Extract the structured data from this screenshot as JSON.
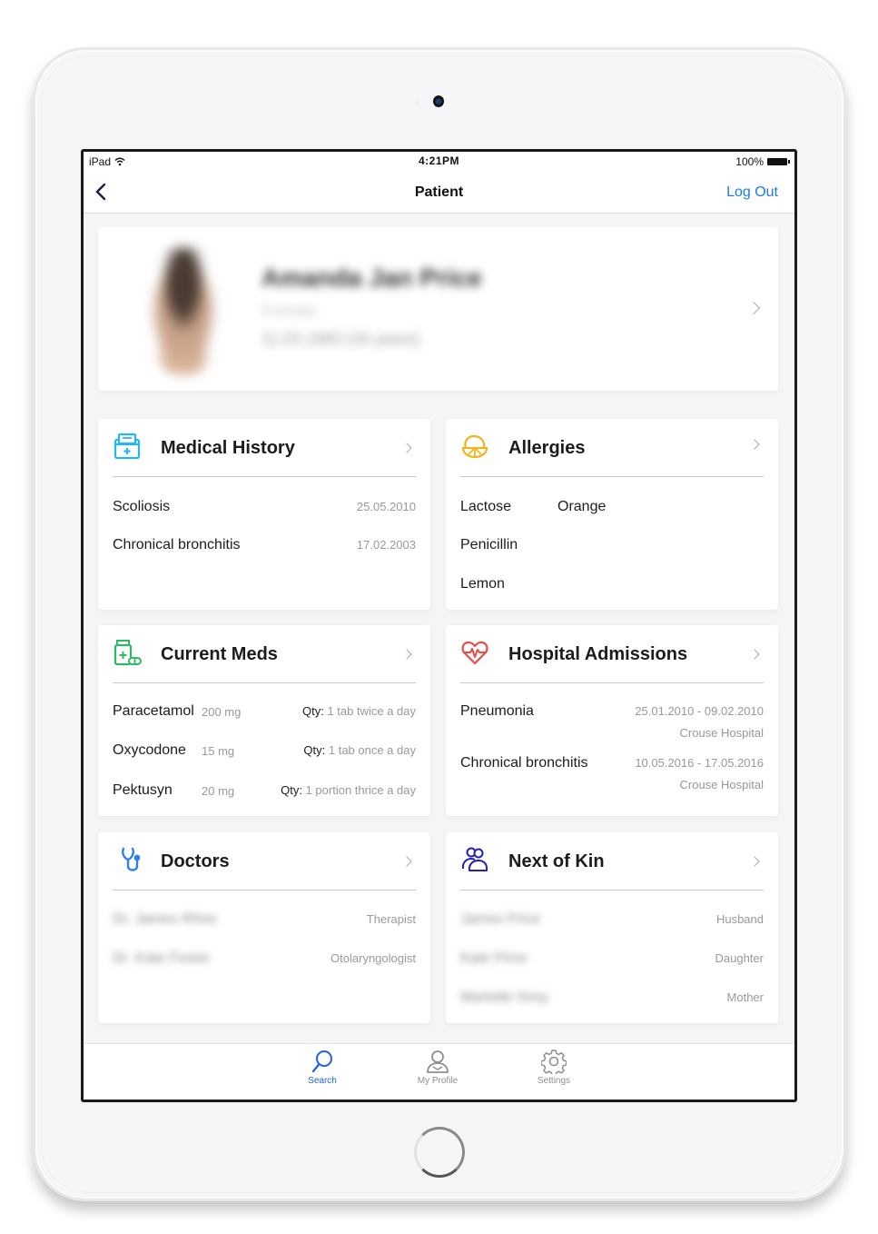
{
  "status_bar": {
    "device": "iPad",
    "time": "4:21PM",
    "battery": "100%"
  },
  "nav": {
    "title": "Patient",
    "logout_label": "Log Out"
  },
  "profile": {
    "name": "Amanda Jan Price",
    "gender": "Female",
    "dob": "11.03.1983 (34 years)",
    "blurred": true
  },
  "sections": {
    "medical_history": {
      "title": "Medical History",
      "icon": "medical-folder-icon",
      "color": "#29b6f0",
      "items": [
        {
          "name": "Scoliosis",
          "date": "25.05.2010"
        },
        {
          "name": "Chronical bronchitis",
          "date": "17.02.2003"
        }
      ]
    },
    "allergies": {
      "title": "Allergies",
      "icon": "lemon-icon",
      "color": "#f0b41c",
      "items": [
        "Lactose",
        "Orange",
        "Penicillin",
        "Lemon"
      ]
    },
    "current_meds": {
      "title": "Current Meds",
      "icon": "pill-bottle-icon",
      "color": "#2fb865",
      "qty_label": "Qty:",
      "items": [
        {
          "name": "Paracetamol",
          "dose": "200 mg",
          "qty": "1 tab twice a day"
        },
        {
          "name": "Oxycodone",
          "dose": "15 mg",
          "qty": "1 tab once a day"
        },
        {
          "name": "Pektusyn",
          "dose": "20 mg",
          "qty": "1 portion thrice a day"
        }
      ]
    },
    "hospital_admissions": {
      "title": "Hospital Admissions",
      "icon": "heart-pulse-icon",
      "color": "#ea4b4b",
      "items": [
        {
          "name": "Pneumonia",
          "dates": "25.01.2010 - 09.02.2010",
          "hospital": "Crouse Hospital"
        },
        {
          "name": "Chronical bronchitis",
          "dates": "10.05.2016 - 17.05.2016",
          "hospital": "Crouse Hospital"
        }
      ]
    },
    "doctors": {
      "title": "Doctors",
      "icon": "stethoscope-icon",
      "color": "#2f7fef",
      "items": [
        {
          "name": "Dr. James Rhee",
          "role": "Therapist"
        },
        {
          "name": "Dr. Kate Foster",
          "role": "Otolaryngologist"
        }
      ]
    },
    "next_of_kin": {
      "title": "Next of Kin",
      "icon": "people-icon",
      "color": "#2420b0",
      "items": [
        {
          "name": "James Price",
          "relation": "Husband"
        },
        {
          "name": "Kate Price",
          "relation": "Daughter"
        },
        {
          "name": "Mariette Grey",
          "relation": "Mother"
        }
      ]
    }
  },
  "tab_bar": {
    "tabs": [
      {
        "label": "Search",
        "icon": "search-icon",
        "active": true
      },
      {
        "label": "My Profile",
        "icon": "person-icon",
        "active": false
      },
      {
        "label": "Settings",
        "icon": "gear-icon",
        "active": false
      }
    ],
    "active_color": "#1e63d8",
    "inactive_color": "#8e8e93"
  }
}
